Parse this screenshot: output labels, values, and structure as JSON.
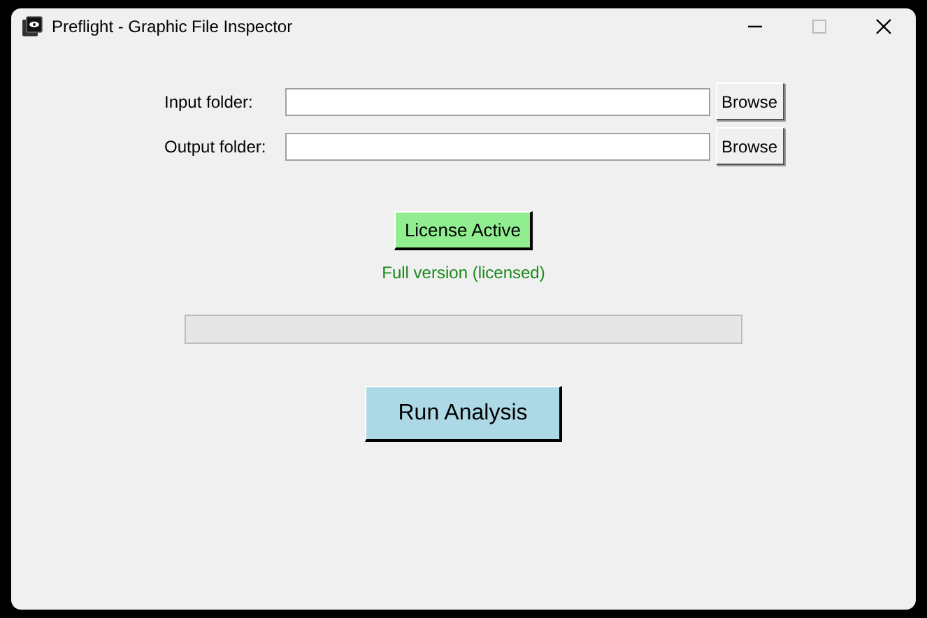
{
  "window": {
    "title": "Preflight - Graphic File Inspector"
  },
  "folders": [
    {
      "label": "Input folder:",
      "button": "Browse"
    },
    {
      "label": "Output folder:",
      "button": "Browse"
    }
  ],
  "license": {
    "button": "License Active",
    "status": "Full version (licensed)",
    "active": true
  },
  "run_button": "Run Analysis"
}
